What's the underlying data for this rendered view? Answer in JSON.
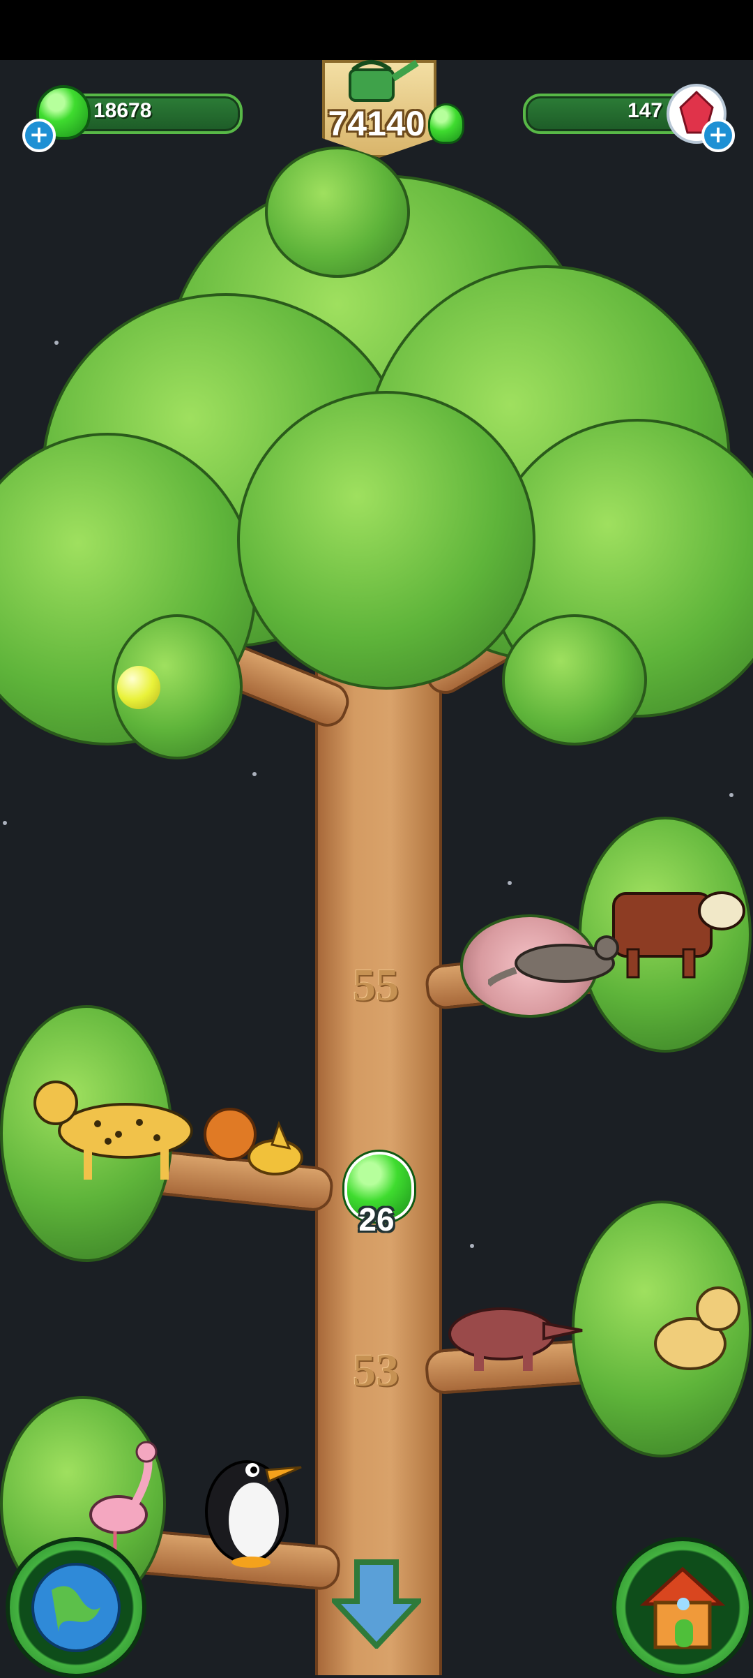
{
  "hud": {
    "gems": {
      "value": "18678",
      "icon": "green-gem-icon"
    },
    "watering_can": {
      "value": "74140",
      "icon": "watering-can-icon"
    },
    "crystals": {
      "value": "147",
      "icon": "red-crystal-icon"
    }
  },
  "tree": {
    "level_labels": [
      "55",
      "53"
    ],
    "current_level": {
      "value": "26",
      "icon": "green-gem-icon"
    }
  },
  "buttons": {
    "globe": "globe-icon",
    "down": "down-arrow-icon",
    "home": "house-icon"
  },
  "animals": [
    "cow",
    "otter",
    "cheetah",
    "squirrel",
    "fox",
    "aardvark",
    "lynx",
    "flamingo",
    "penguin"
  ]
}
